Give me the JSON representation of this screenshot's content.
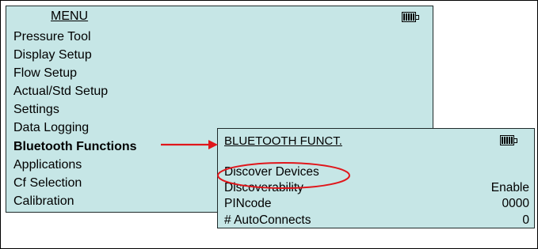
{
  "main_menu": {
    "title": "MENU",
    "items": [
      {
        "label": "Pressure Tool"
      },
      {
        "label": "Display Setup"
      },
      {
        "label": "Flow Setup"
      },
      {
        "label": "Actual/Std Setup"
      },
      {
        "label": "Settings"
      },
      {
        "label": "Data Logging"
      },
      {
        "label": "Bluetooth Functions",
        "selected": true
      },
      {
        "label": "Applications"
      },
      {
        "label": "Cf Selection"
      },
      {
        "label": "Calibration"
      }
    ],
    "battery_icon": "battery-full-icon"
  },
  "bluetooth_menu": {
    "title": "BLUETOOTH FUNCT.",
    "battery_icon": "battery-full-icon",
    "rows": [
      {
        "label": "Discover Devices",
        "value": ""
      },
      {
        "label": "Discoverability",
        "value": "Enable"
      },
      {
        "label": "PINcode",
        "value": "0000"
      },
      {
        "label": "# AutoConnects",
        "value": "0"
      }
    ]
  },
  "annotations": {
    "arrow_color": "#e0161b",
    "highlight_oval_color": "#e0161b"
  },
  "colors": {
    "screen_background": "#c6e6e6"
  }
}
